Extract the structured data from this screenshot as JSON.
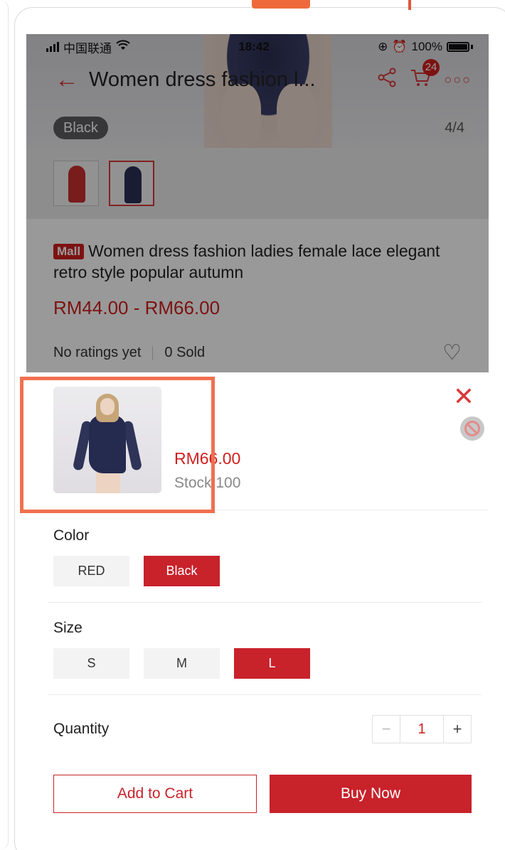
{
  "status_bar": {
    "carrier": "中国联通",
    "wifi_icon": "wifi-icon",
    "time": "18:42",
    "battery": "100%"
  },
  "nav": {
    "title": "Women dress fashion l...",
    "cart_count": "24"
  },
  "gallery": {
    "variant_chip": "Black",
    "image_counter": "4/4",
    "thumbs": [
      "red dress",
      "navy dress"
    ]
  },
  "product": {
    "mall_badge": "Mall",
    "title": "Women dress fashion ladies female lace elegant retro style popular autumn",
    "price_range": "RM44.00 - RM66.00",
    "ratings": "No ratings yet",
    "sold": "0 Sold"
  },
  "sheet": {
    "price": "RM66.00",
    "stock": "Stock 100",
    "color_label": "Color",
    "colors": [
      "RED",
      "Black"
    ],
    "selected_color": "Black",
    "size_label": "Size",
    "sizes": [
      "S",
      "M",
      "L"
    ],
    "selected_size": "L",
    "quantity_label": "Quantity",
    "quantity": "1",
    "add_to_cart": "Add to Cart",
    "buy_now": "Buy Now"
  },
  "colors": {
    "accent": "#c8222b",
    "highlight": "#f07050"
  }
}
